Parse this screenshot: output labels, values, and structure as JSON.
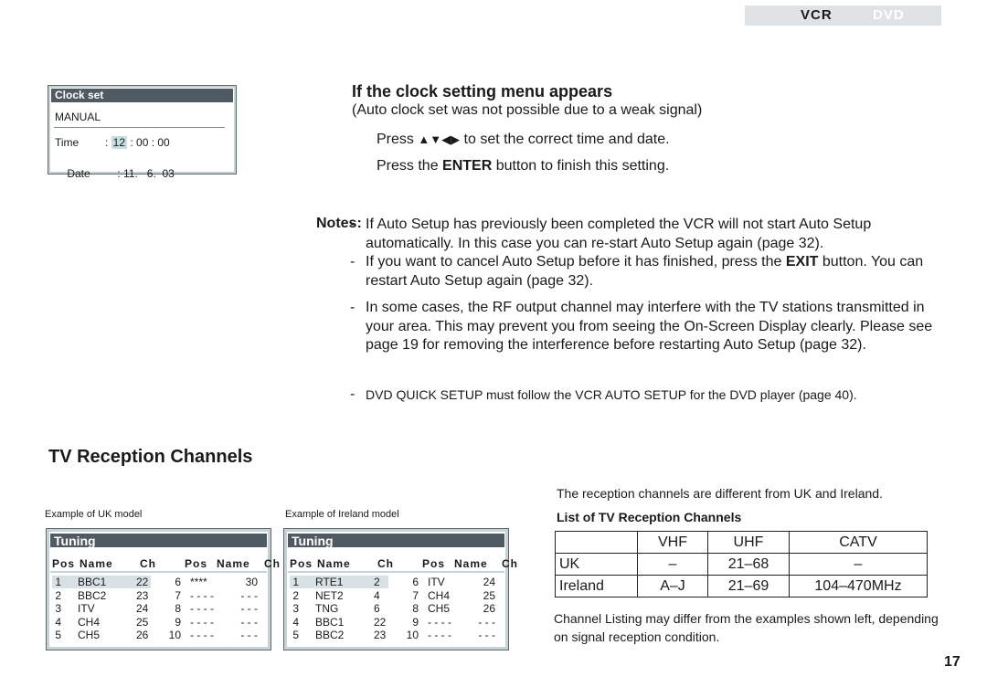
{
  "mode_tabs": {
    "active": "VCR",
    "inactive": "DVD"
  },
  "clock_osd": {
    "title": "Clock set",
    "mode": "MANUAL",
    "time_label": "Time",
    "time_prefix": ": ",
    "time_hour": "12",
    "time_rest": " : 00 : 00",
    "date_label": "Date",
    "date_value": ": 11.   6.  03"
  },
  "clock_section": {
    "heading": "If the clock setting menu appears",
    "subtitle": "(Auto clock set was not possible due to a weak signal)",
    "step1_pre": "Press ",
    "step1_arrows": "▲▼◀▶",
    "step1_post": " to set the correct time and date.",
    "step2_pre": "Press the ",
    "step2_bold": "ENTER",
    "step2_post": " button to finish this setting."
  },
  "notes": {
    "label": "Notes:",
    "items": [
      {
        "text": "If Auto Setup has previously been completed the VCR will not start Auto Setup automatically. In this case you can re-start Auto Setup again (page 32)."
      },
      {
        "pre": "If you want to cancel Auto Setup before it has finished, press the ",
        "bold": "EXIT",
        "post": " button. You can restart Auto Setup again (page 32)."
      },
      {
        "text": "In some cases, the RF output channel may interfere with the TV stations transmitted in your area. This may prevent you from seeing the On-Screen Display clearly. Please see page 19 for removing the interference before restarting Auto Setup (page 32)."
      },
      {
        "text": "DVD QUICK SETUP must follow the VCR AUTO SETUP for the DVD player (page 40)."
      }
    ]
  },
  "tv_section": {
    "heading": "TV Reception Channels",
    "uk_caption": "Example of UK model",
    "ie_caption": "Example of Ireland model",
    "tuning_title": "Tuning",
    "headers": {
      "pos": "Pos",
      "name": "Name",
      "ch": "Ch"
    },
    "uk_rows": [
      {
        "pos": "1",
        "name": "BBC1",
        "ch": "22",
        "pos2": "6",
        "name2": "****",
        "ch2": "30"
      },
      {
        "pos": "2",
        "name": "BBC2",
        "ch": "23",
        "pos2": "7",
        "name2": "- - - -",
        "ch2": "- - -"
      },
      {
        "pos": "3",
        "name": "ITV",
        "ch": "24",
        "pos2": "8",
        "name2": "- - - -",
        "ch2": "- - -"
      },
      {
        "pos": "4",
        "name": "CH4",
        "ch": "25",
        "pos2": "9",
        "name2": "- - - -",
        "ch2": "- - -"
      },
      {
        "pos": "5",
        "name": "CH5",
        "ch": "26",
        "pos2": "10",
        "name2": "- - - -",
        "ch2": "- - -"
      }
    ],
    "ie_rows": [
      {
        "pos": "1",
        "name": "RTE1",
        "ch": "2",
        "pos2": "6",
        "name2": "ITV",
        "ch2": "24"
      },
      {
        "pos": "2",
        "name": "NET2",
        "ch": "4",
        "pos2": "7",
        "name2": "CH4",
        "ch2": "25"
      },
      {
        "pos": "3",
        "name": "TNG",
        "ch": "6",
        "pos2": "8",
        "name2": "CH5",
        "ch2": "26"
      },
      {
        "pos": "4",
        "name": "BBC1",
        "ch": "22",
        "pos2": "9",
        "name2": "- - - -",
        "ch2": "- - -"
      },
      {
        "pos": "5",
        "name": "BBC2",
        "ch": "23",
        "pos2": "10",
        "name2": "- - - -",
        "ch2": "- - -"
      }
    ],
    "diff_text": "The reception channels are different from UK and Ireland.",
    "list_heading": "List of TV Reception Channels",
    "table": {
      "header": [
        "",
        "VHF",
        "UHF",
        "CATV"
      ],
      "rows": [
        [
          "UK",
          "–",
          "21–68",
          "–"
        ],
        [
          "Ireland",
          "A–J",
          "21–69",
          "104–470MHz"
        ]
      ]
    },
    "listing_note": "Channel Listing may differ from the examples shown left, depending on signal reception condition."
  },
  "page_number": "17"
}
